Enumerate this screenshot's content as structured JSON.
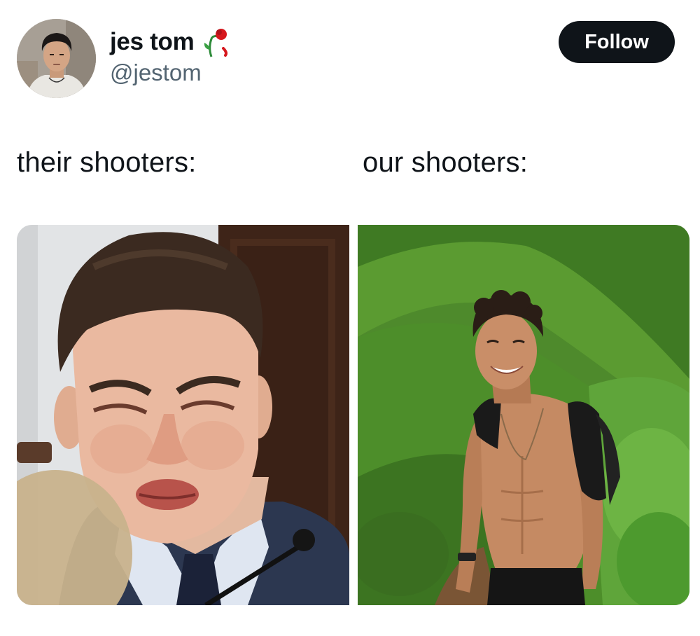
{
  "tweet": {
    "author": {
      "display_name": "jes tom",
      "handle": "@jestom",
      "avatar_icon": "profile-photo",
      "badge_icon": "wilted-rose-icon"
    },
    "follow_label": "Follow",
    "captions": {
      "left": "their shooters:",
      "right": "our shooters:"
    },
    "media": [
      {
        "subject": "crying-man-in-suit-photo"
      },
      {
        "subject": "shirtless-hiker-photo"
      }
    ]
  },
  "colors": {
    "text_primary": "#0f1419",
    "text_secondary": "#536471",
    "button_bg": "#0f1419",
    "button_text": "#ffffff",
    "rose": "#d6171d"
  }
}
